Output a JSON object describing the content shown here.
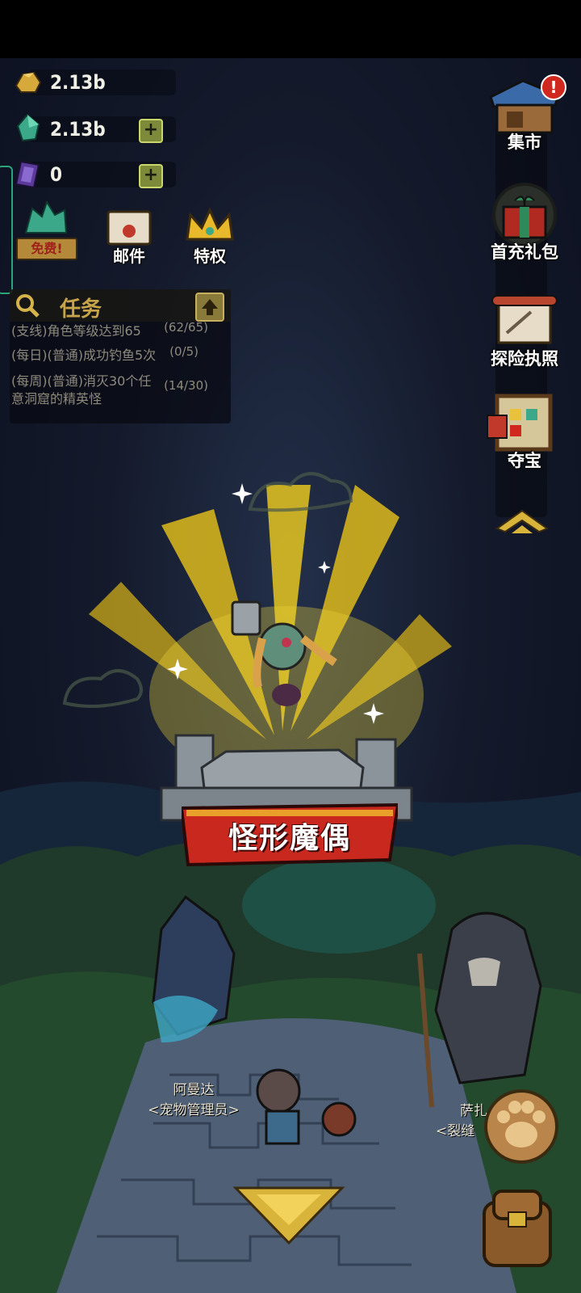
{
  "currencies": {
    "gold": {
      "value": "2.13b",
      "icon": "gold-ore-icon"
    },
    "gems": {
      "value": "2.13b",
      "icon": "gem-icon"
    },
    "cards": {
      "value": "0",
      "icon": "purple-card-icon"
    }
  },
  "quick_buttons": [
    {
      "label": "",
      "badge": "免费!",
      "icon": "crystal-chest-icon"
    },
    {
      "label": "邮件",
      "icon": "mail-icon"
    },
    {
      "label": "特权",
      "icon": "crown-icon"
    }
  ],
  "quests": {
    "title": "任务",
    "items": [
      {
        "text": "(支线)角色等级达到65",
        "progress": "(62/65)"
      },
      {
        "text": "(每日)(普通)成功钓鱼5次",
        "progress": "(0/5)"
      },
      {
        "text_line1": "(每周)(普通)消灭30个任",
        "text_line2": "意洞窟的精英怪",
        "progress": "(14/30)"
      }
    ]
  },
  "right_menu": [
    {
      "label": "集市",
      "icon": "market-stall-icon",
      "alert": "!"
    },
    {
      "label": "首充礼包",
      "icon": "gift-box-icon"
    },
    {
      "label": "探险执照",
      "icon": "scroll-icon"
    },
    {
      "label": "夺宝",
      "icon": "treasure-board-icon"
    }
  ],
  "boss_banner": "怪形魔偶",
  "npcs": [
    {
      "name": "阿曼达",
      "title": "<宠物管理员>"
    },
    {
      "name": "萨扎",
      "title": "<裂缝"
    }
  ],
  "colors": {
    "accent_gold": "#f2c419",
    "banner_red": "#c8281e",
    "quest_title": "#c7a34a"
  }
}
